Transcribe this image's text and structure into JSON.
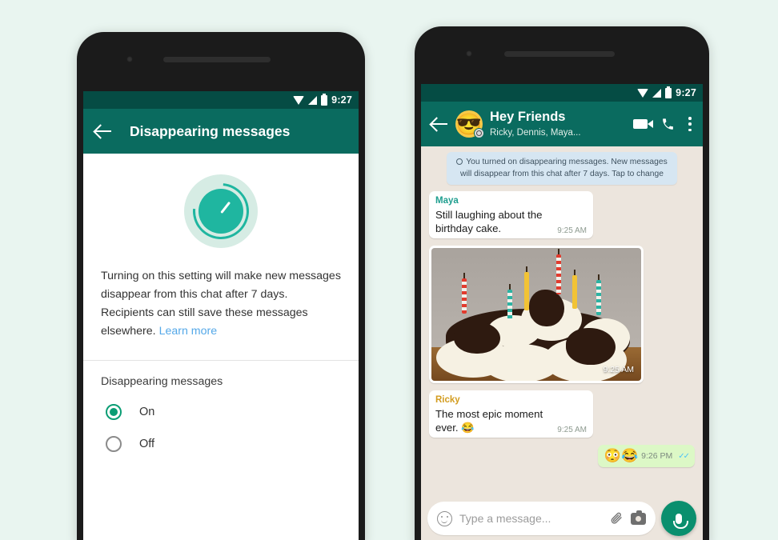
{
  "theme": {
    "page_bg": "#e9f5f0",
    "header_green": "#0a6b5f",
    "statusbar_green": "#054c44",
    "accent_teal": "#1fb6a0",
    "radio_on": "#0a9d74",
    "link_blue": "#54a8e8",
    "chat_bg": "#ece5dd",
    "outgoing_bubble": "#dcf8c6",
    "system_bubble": "#d6e6f2",
    "name_maya": "#1f9e8f",
    "name_ricky": "#d39c1f",
    "tick_blue": "#4fc3f7",
    "mic_green": "#0a8f6e"
  },
  "left_phone": {
    "statusbar": {
      "time": "9:27",
      "icons": [
        "wifi-icon",
        "signal-icon",
        "battery-icon"
      ]
    },
    "appbar": {
      "back_icon": "back-arrow-icon",
      "title": "Disappearing messages"
    },
    "hero_icon": "disappearing-timer-icon",
    "description": "Turning on this setting will make new messages disappear from this chat after 7 days. Recipients can still save these messages elsewhere.",
    "learn_more": "Learn more",
    "section_label": "Disappearing messages",
    "options": [
      {
        "label": "On",
        "selected": true
      },
      {
        "label": "Off",
        "selected": false
      }
    ]
  },
  "right_phone": {
    "statusbar": {
      "time": "9:27",
      "icons": [
        "wifi-icon",
        "signal-icon",
        "battery-icon"
      ]
    },
    "chatbar": {
      "back_icon": "back-arrow-icon",
      "avatar_emoji": "😎",
      "avatar_badge": "timer-badge-icon",
      "title": "Hey Friends",
      "subtitle": "Ricky, Dennis, Maya...",
      "actions": [
        "video-call-icon",
        "voice-call-icon",
        "overflow-menu-icon"
      ]
    },
    "system_message": "You turned on disappearing messages. New messages will disappear from this chat after 7 days. Tap to change",
    "messages": [
      {
        "type": "text",
        "direction": "in",
        "sender": "Maya",
        "text": "Still laughing about the birthday cake.",
        "time": "9:25 AM"
      },
      {
        "type": "photo",
        "direction": "in",
        "caption": "birthday-cake-photo",
        "time": "9:25 AM"
      },
      {
        "type": "text",
        "direction": "in",
        "sender": "Ricky",
        "text": "The most epic moment ever. 😂",
        "time": "9:25 AM"
      },
      {
        "type": "emoji",
        "direction": "out",
        "emojis": "😳😂",
        "time": "9:26 PM",
        "status": "read"
      }
    ],
    "input_bar": {
      "emoji_icon": "smiley-icon",
      "placeholder": "Type a message...",
      "value": "",
      "attach_icon": "paperclip-icon",
      "camera_icon": "camera-icon",
      "mic_icon": "microphone-icon"
    }
  }
}
